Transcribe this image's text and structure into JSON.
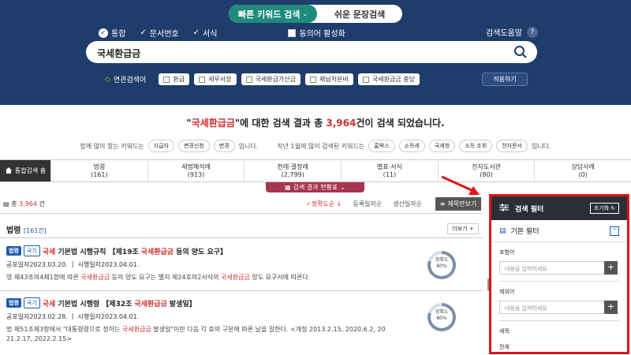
{
  "search_mode": {
    "active": "빠른 키워드 검색",
    "inactive": "쉬운 문장검색"
  },
  "options": {
    "integrated": "통합",
    "doc_no": "문서번호",
    "form": "서식",
    "synonym": "동의어 활성화"
  },
  "help": {
    "label": "검색도움말",
    "icon": "?"
  },
  "search": {
    "value": "국세환급금"
  },
  "related": {
    "label": "연관검색어",
    "chips": [
      "환급",
      "세무서장",
      "국세환급가산금",
      "체납처분비",
      "국세환급금 충당"
    ],
    "apply": "적용하기"
  },
  "summary": {
    "pre": "\"",
    "query": "국세환급금",
    "mid": "\"에 대한 검색 결과 총 ",
    "count": "3,964",
    "post": "건이 검색 되었습니다."
  },
  "keywords": {
    "lead1": "함께 많이 찾는 키워드는",
    "kw1": [
      "지급자",
      "변경신청",
      "변경"
    ],
    "tail1": "입니다.",
    "lead2": "작년 1월에 많이 검색된 키워드는",
    "kw2": [
      "홈택스",
      "소득세",
      "국세청",
      "소득 조회",
      "전자문서"
    ],
    "tail2": "입니다."
  },
  "tabs": {
    "home": "통합검색 홈",
    "items": [
      {
        "label": "법령",
        "count": "(161)"
      },
      {
        "label": "세법해석례",
        "count": "(913)"
      },
      {
        "label": "판례·결정례",
        "count": "(2,799)"
      },
      {
        "label": "별표·서식",
        "count": "(11)"
      },
      {
        "label": "전자도서관",
        "count": "(80)"
      },
      {
        "label": "상담사례",
        "count": "(0)"
      }
    ]
  },
  "status_btn": "검색 결과 현황표",
  "results_bar": {
    "total_pre": "총 ",
    "total": "3,964",
    "total_post": " 건",
    "sort": [
      "정확도순 ↓",
      "등록일자순",
      "생산일자순"
    ],
    "title_only": "제목만보기"
  },
  "section": {
    "title": "법령",
    "count": "[161건]",
    "more": "더보기 +"
  },
  "items": [
    {
      "badge1": "법령",
      "badge2": "국기",
      "title_a": "국세",
      "title_b": "기본법 시행규칙 【제19조 ",
      "title_c": "국세환급금",
      "title_d": " 등의 양도 요구】",
      "date1": "공포일자2023.03.20.",
      "date2": "시행일자2023.04.01.",
      "body_a": "영 제43조의4제1항에 따른 ",
      "body_b": "국세환급금",
      "body_c": " 등의 양도 요구는 별지 제24호의2서식의 ",
      "body_d": "국세환급금",
      "body_e": " 양도 요구서에 따른다.",
      "acc_label": "정확도",
      "acc": "80%",
      "acc_value": 0.8
    },
    {
      "badge1": "법령",
      "badge2": "국기",
      "title_a": "국세",
      "title_b": "기본법 시행령 【제32조 ",
      "title_c": "국세환급금",
      "title_d": " 발생일】",
      "date1": "공포일자2023.02.28.",
      "date2": "시행일자2023.04.01.",
      "body_a": "법 제51조제3항에서 \"대통령령으로 정하는 ",
      "body_b": "국세환급금",
      "body_c": " 발생일\"이란 다음 각 호의 구분에 따른 날을 말한다. <개정 2013.2.15, 2020.6.2, 20",
      "body_d": "",
      "body_e": "21.2.17, 2022.2.15>",
      "acc_label": "정확도",
      "acc": "80%",
      "acc_value": 0.8
    }
  ],
  "filter": {
    "title": "검색 필터",
    "reset": "초기화",
    "basic": "기본 필터",
    "include_label": "포함어",
    "include_ph": "내용을 입력하세요",
    "exclude_label": "제외어",
    "exclude_ph": "내용을 입력하세요",
    "tax_label": "세목",
    "tax_value": "전체"
  },
  "colors": {
    "navy": "#1f3d6b",
    "teal": "#1e8b7c",
    "red": "#d32f2f",
    "highlight_border": "#e0141a"
  }
}
